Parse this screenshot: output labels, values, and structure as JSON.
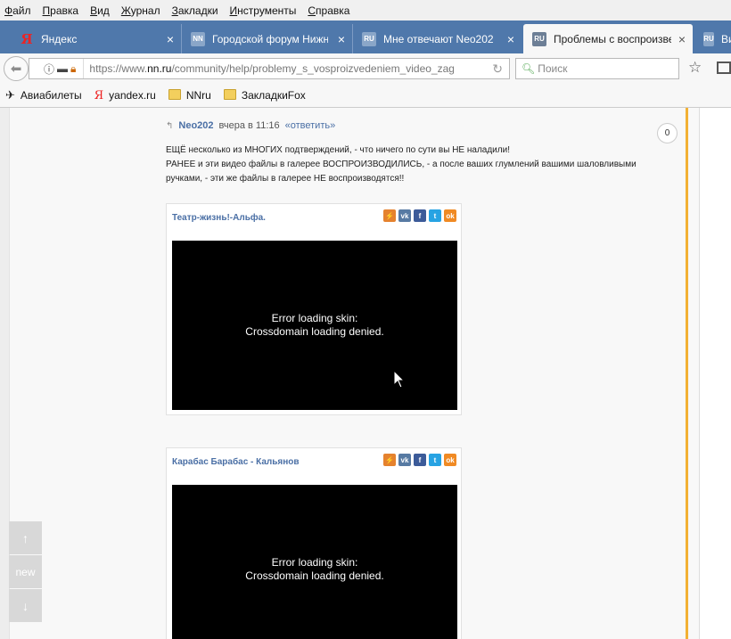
{
  "menu": {
    "items": [
      {
        "underline": "Ф",
        "rest": "айл"
      },
      {
        "underline": "П",
        "rest": "равка"
      },
      {
        "underline": "В",
        "rest": "ид"
      },
      {
        "underline": "Ж",
        "rest": "урнал"
      },
      {
        "underline": "З",
        "rest": "акладки"
      },
      {
        "underline": "И",
        "rest": "нструменты"
      },
      {
        "underline": "С",
        "rest": "правка"
      }
    ]
  },
  "tabs": [
    {
      "icon": "Я",
      "title": "Яндекс",
      "close": "×"
    },
    {
      "icon": "NN",
      "title": "Городской форум Нижн...",
      "close": "×"
    },
    {
      "icon": "RU",
      "title": "Мне отвечают Neo202",
      "close": "×"
    },
    {
      "icon": "RU",
      "title": "Проблемы с воспроизве...",
      "close": "×"
    },
    {
      "icon": "RU",
      "title": "Ви"
    }
  ],
  "navbar": {
    "url_prefix": "https://www.",
    "url_domain": "nn.ru",
    "url_path": "/community/help/problemy_s_vosproizvedeniem_video_zagruzheni",
    "search_placeholder": "Поиск"
  },
  "bookmarks": [
    {
      "label": "Авиабилеты",
      "icon": "plane-icon"
    },
    {
      "label": "yandex.ru",
      "icon": "yandex-icon"
    },
    {
      "label": "NNru",
      "icon": "folder-icon"
    },
    {
      "label": "ЗакладкиFox",
      "icon": "folder-icon"
    }
  ],
  "comment": {
    "author": "Neo202",
    "time": "вчера в 11:16",
    "reply_link": "«ответить»",
    "rating": "0",
    "lines": [
      "ЕЩЁ несколько из МНОГИХ подтверждений, - что ничего по сути вы НЕ наладили!",
      "РАНЕЕ и эти видео файлы в галерее ВОСПРОИЗВОДИЛИСЬ, - а после ваших глумлений вашими шаловливыми",
      "ручками, - эти же файлы в галерее НЕ воспроизводятся!!"
    ]
  },
  "videos": [
    {
      "title": "Театр-жизнь!-Альфа.",
      "error_line1": "Error loading skin:",
      "error_line2": "Crossdomain loading denied."
    },
    {
      "title": "Карабас Барабас - Кальянов",
      "error_line1": "Error loading skin:",
      "error_line2": "Crossdomain loading denied."
    }
  ],
  "share": [
    "⚡",
    "vk",
    "f",
    "t",
    "ok"
  ],
  "side_buttons": {
    "up": "↑",
    "new": "new",
    "down": "↓"
  },
  "colors": {
    "tabstrip": "#4f78ab",
    "link": "#4a6fa5",
    "accent_bar": "#f2b134"
  }
}
